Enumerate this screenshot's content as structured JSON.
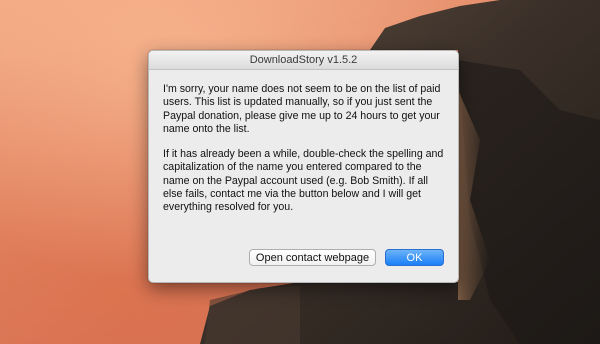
{
  "dialog": {
    "title": "DownloadStory v1.5.2",
    "paragraph1": "I'm sorry, your name does not seem to be on the list of paid users.  This list is updated manually, so if you just sent the Paypal donation, please give me up to 24 hours to get your name onto the list.",
    "paragraph2": "If it has already been a while, double-check the spelling and capitalization of the name you entered compared to the name on the Paypal account used (e.g. Bob Smith).  If all else fails, contact me via the button below and I will get everything resolved for you.",
    "contact_button": "Open contact webpage",
    "ok_button": "OK"
  },
  "colors": {
    "sky": "#e58c6a",
    "cliff": "#2a2520",
    "accent": "#1a7ef6"
  }
}
